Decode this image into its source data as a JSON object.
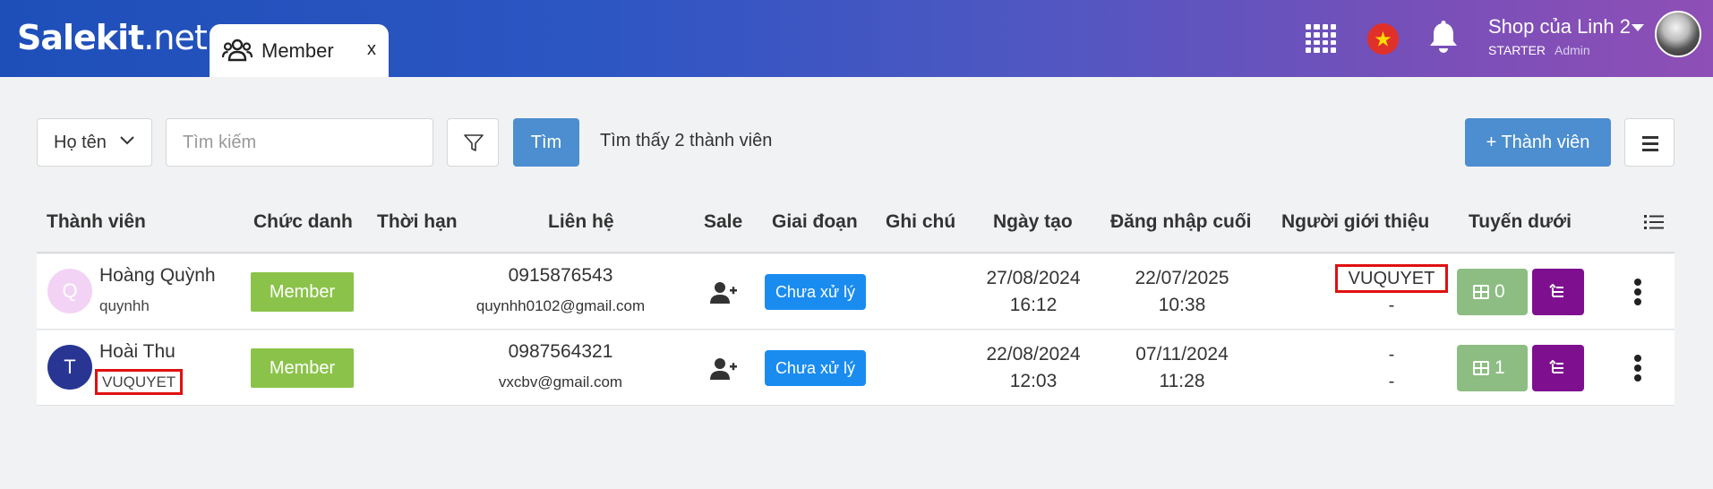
{
  "header": {
    "logo_main": "Salekit",
    "logo_suffix": ".net",
    "tab_label": "Member",
    "tab_close": "x",
    "shop_name": "Shop của Linh 2",
    "plan": "STARTER",
    "role": "Admin",
    "icons": [
      "users-icon",
      "apps-grid-icon",
      "vietnam-flag-icon",
      "bell-icon",
      "user-avatar"
    ]
  },
  "toolbar": {
    "select_label": "Họ tên",
    "search_placeholder": "Tìm kiếm",
    "find_label": "Tìm",
    "result_text": "Tìm thấy 2 thành viên",
    "add_label": "+ Thành viên"
  },
  "table": {
    "columns": [
      "Thành viên",
      "Chức danh",
      "Thời hạn",
      "Liên hệ",
      "Sale",
      "Giai đoạn",
      "Ghi chú",
      "Ngày tạo",
      "Đăng nhập cuối",
      "Người giới thiệu",
      "Tuyến dưới"
    ],
    "rows": [
      {
        "avatar_letter": "Q",
        "avatar_color": "#f3d3f5",
        "name": "Hoàng Quỳnh",
        "username": "quynhh",
        "role": "Member",
        "duration": "",
        "phone": "0915876543",
        "email": "quynhh0102@gmail.com",
        "stage": "Chưa xử lý",
        "note": "",
        "created_date": "27/08/2024",
        "created_time": "16:12",
        "login_date": "22/07/2025",
        "login_time": "10:38",
        "referrer_line1": "VUQUYET",
        "referrer_line2": "-",
        "downline_count": "0"
      },
      {
        "avatar_letter": "T",
        "avatar_color": "#283593",
        "name": "Hoài Thu",
        "username": "VUQUYET",
        "role": "Member",
        "duration": "",
        "phone": "0987564321",
        "email": "vxcbv@gmail.com",
        "stage": "Chưa xử lý",
        "note": "",
        "created_date": "22/08/2024",
        "created_time": "12:03",
        "login_date": "07/11/2024",
        "login_time": "11:28",
        "referrer_line1": "-",
        "referrer_line2": "-",
        "downline_count": "1"
      }
    ]
  },
  "colors": {
    "accent_blue": "#4c8ecf",
    "stage_blue": "#1a8cf0",
    "role_green": "#8bc34a",
    "downline_green": "#8dbd82",
    "tree_purple": "#7e1090",
    "highlight_red": "#e01010"
  }
}
